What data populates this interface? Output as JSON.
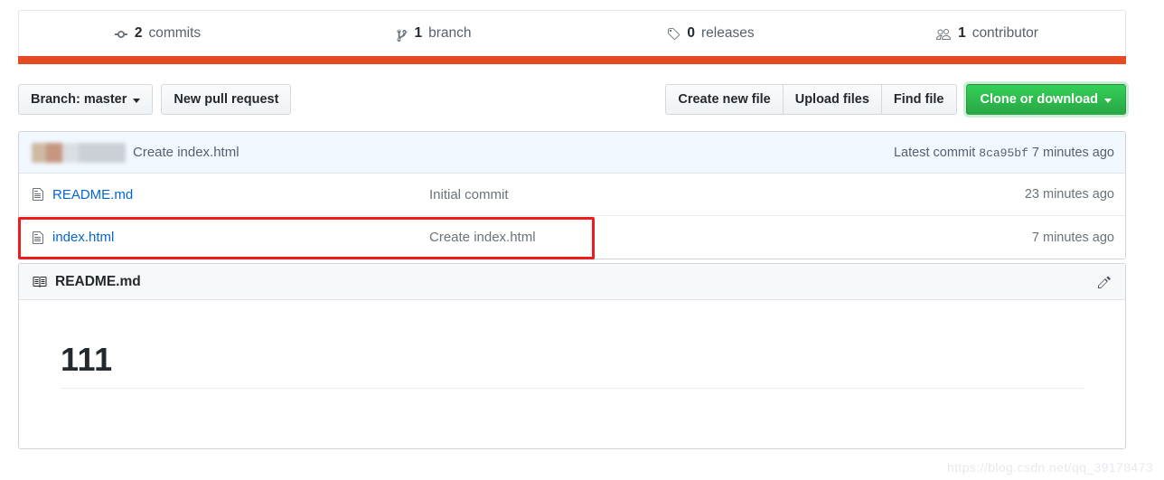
{
  "colors": {
    "language_bar": "#e44b23",
    "link_blue": "#0366d6",
    "green_button": "#28a745",
    "annotation_red": "#ee1c1c",
    "commit_bar_bg": "#f1f8ff"
  },
  "stats": [
    {
      "icon": "commit-icon",
      "count": "2",
      "label": "commits"
    },
    {
      "icon": "branch-icon",
      "count": "1",
      "label": "branch"
    },
    {
      "icon": "tag-icon",
      "count": "0",
      "label": "releases"
    },
    {
      "icon": "people-icon",
      "count": "1",
      "label": "contributor"
    }
  ],
  "toolbar": {
    "branch_button": "Branch: master",
    "new_pull_request": "New pull request",
    "create_new_file": "Create new file",
    "upload_files": "Upload files",
    "find_file": "Find file",
    "clone_or_download": "Clone or download"
  },
  "latest_commit": {
    "author_redacted": "",
    "message": "Create index.html",
    "prefix": "Latest commit",
    "sha": "8ca95bf",
    "time": "7 minutes ago"
  },
  "files": [
    {
      "icon": "file-icon",
      "name": "README.md",
      "message": "Initial commit",
      "time": "23 minutes ago"
    },
    {
      "icon": "file-icon",
      "name": "index.html",
      "message": "Create index.html",
      "time": "7 minutes ago"
    }
  ],
  "readme": {
    "icon": "book-icon",
    "title": "README.md",
    "edit_icon": "pencil-icon",
    "heading": "111"
  },
  "watermark": "https://blog.csdn.net/qq_39178473"
}
